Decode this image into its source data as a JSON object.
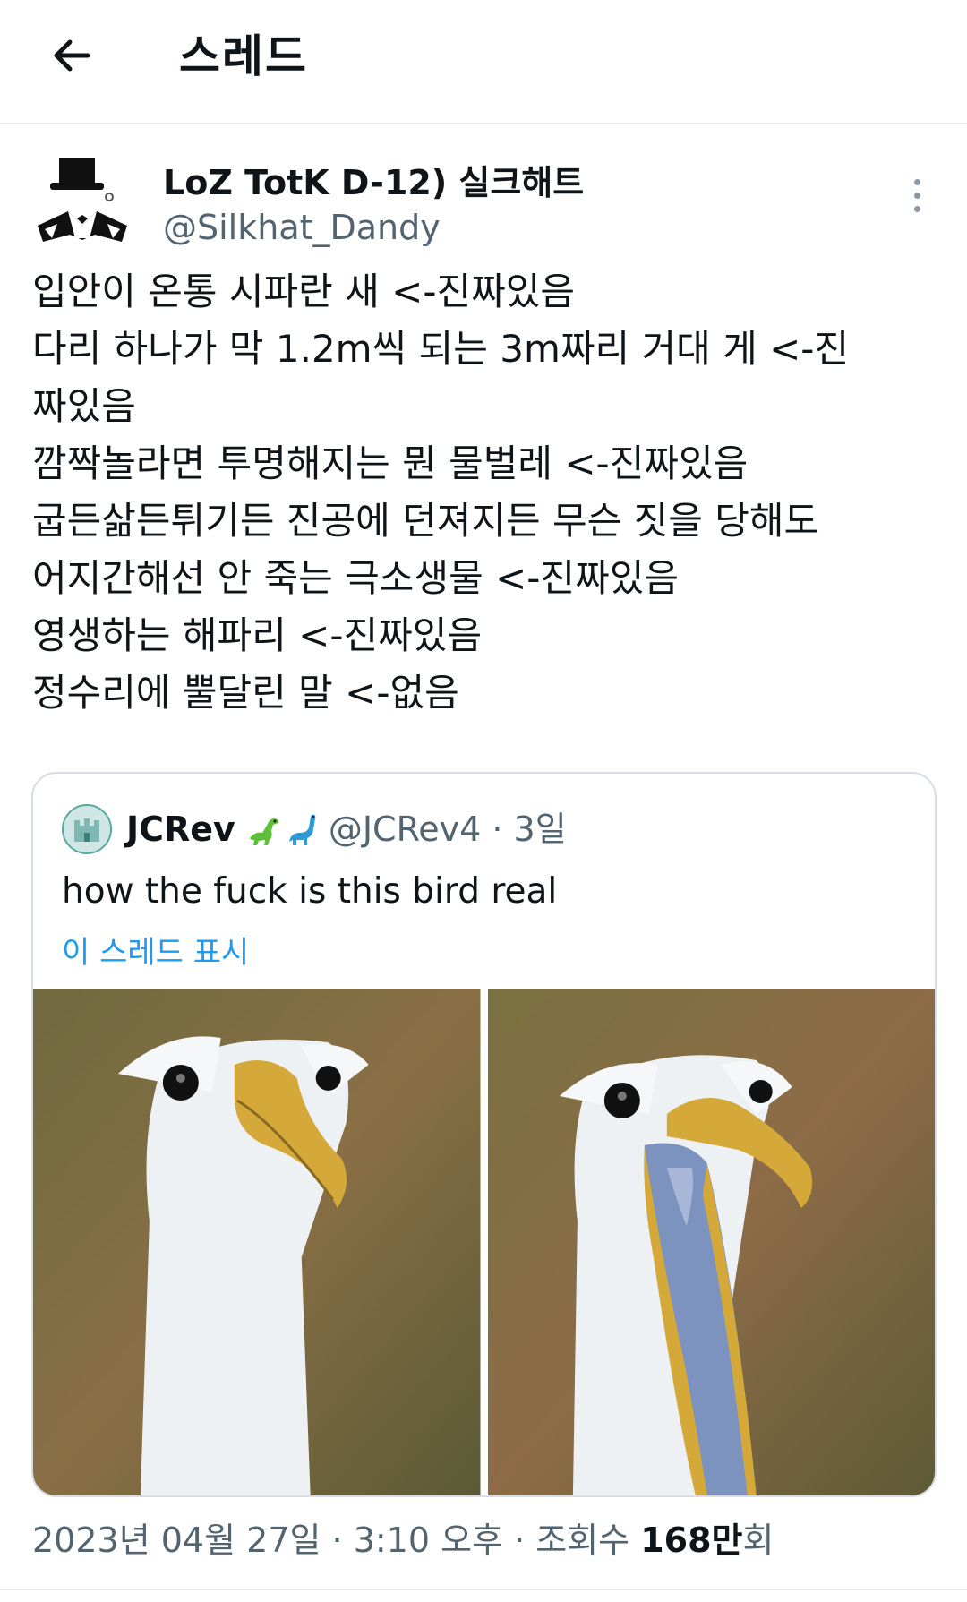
{
  "header": {
    "title": "스레드"
  },
  "author": {
    "display_name": "LoZ TotK D-12) 실크해트",
    "handle": "@Silkhat_Dandy"
  },
  "tweet": {
    "lines": [
      "입안이 온통 시파란 새 <-진짜있음",
      "다리 하나가 막 1.2m씩 되는 3m짜리 거대 게 <-진",
      "짜있음",
      "깜짝놀라면 투명해지는 뭔 물벌레 <-진짜있음",
      "굽든삶든튀기든 진공에 던져지든 무슨 짓을 당해도",
      "어지간해선 안 죽는 극소생물 <-진짜있음",
      "영생하는 해파리 <-진짜있음",
      "정수리에 뿔달린 말 <-없음"
    ]
  },
  "quote": {
    "name": "JCRev",
    "emoji": "🦖🦕",
    "handle_time": "@JCRev4 · 3일",
    "text": "how the fuck is this bird real",
    "show_thread": "이 스레드 표시"
  },
  "meta": {
    "date": "2023년 04월 27일 · 3:10 오후 · 조회수 ",
    "views": "168만",
    "views_suffix": "회"
  },
  "colors": {
    "link": "#1d9bf0",
    "secondary": "#536471",
    "border": "#d7dde2"
  },
  "icons": {
    "back": "arrow-left-icon",
    "more": "more-vertical-icon",
    "quote_avatar": "castle-avatar-icon"
  }
}
